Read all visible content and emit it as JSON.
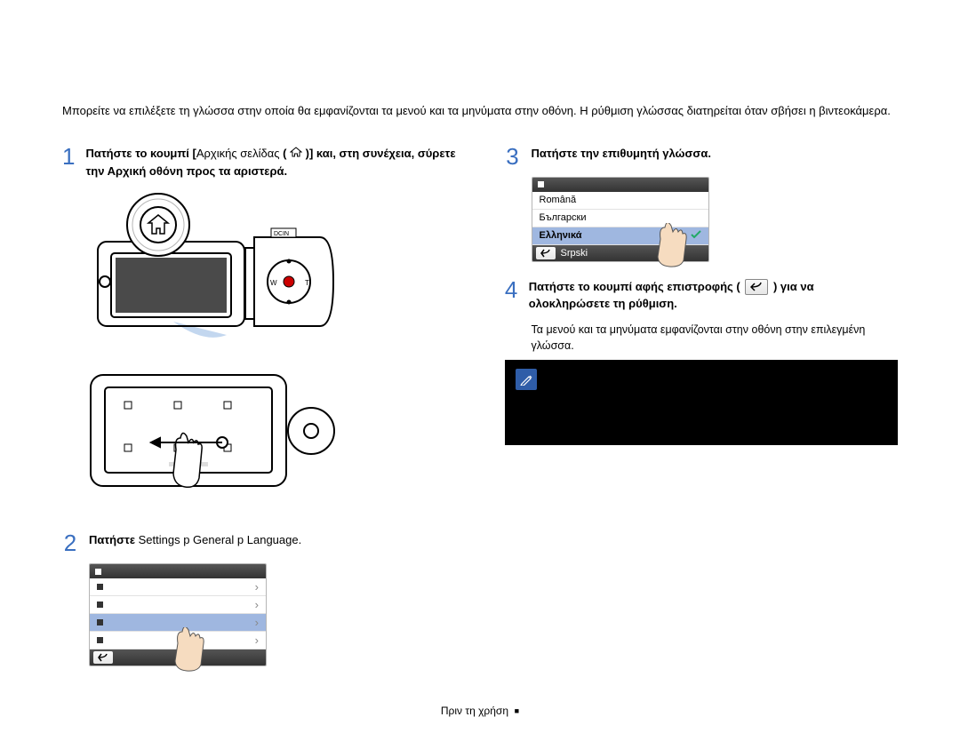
{
  "intro": "Μπορείτε να επιλέξετε τη γλώσσα στην οποία θα εμφανίζονται τα μενού και τα μηνύματα στην οθόνη. Η ρύθμιση γλώσσας διατηρείται όταν σβήσει η βιντεοκάμερα.",
  "step1_a": "Πατήστε το κουμπί [",
  "step1_b": "Αρχικής σελίδας",
  "step1_c": " ( ",
  "step1_d": " )] και, στη συνέχεια, σύρετε την Αρχική οθόνη προς τα αριστερά.",
  "step2_a": "Πατήστε ",
  "step2_b": "Settings",
  "step2_c": " p General p Language.",
  "step3": "Πατήστε την επιθυμητή γλώσσα.",
  "step4_a": "Πατήστε το κουμπί αφής επιστροφής (",
  "step4_b": ") για να ολοκληρώσετε τη ρύθμιση.",
  "sub4": "Τα μενού και τα μηνύματα εμφανίζονται στην οθόνη στην επιλεγμένη γλώσσα.",
  "lang_opts": [
    "Română",
    "Български",
    "Ελληνικά",
    "Srpski"
  ],
  "footer": "Πριν τη χρήση",
  "dcin": "DCIN",
  "wt_w": "W",
  "wt_t": "T"
}
